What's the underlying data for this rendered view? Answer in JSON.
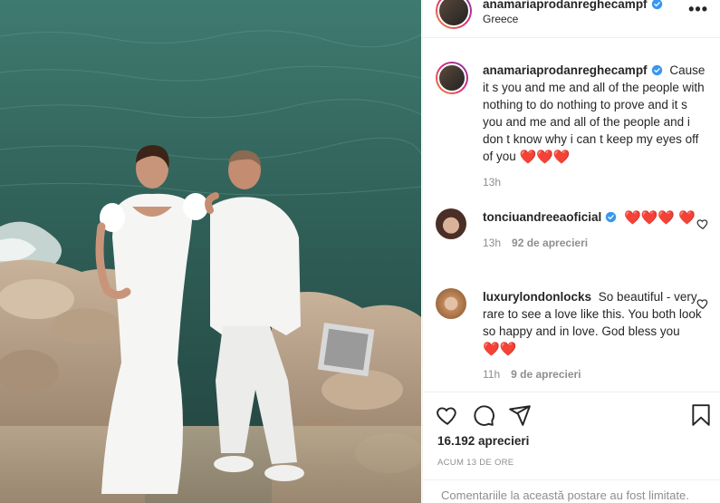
{
  "post": {
    "author": "anamariaprodanreghecampf",
    "location": "Greece",
    "more_icon": "more-horizontal-icon"
  },
  "caption": {
    "username": "anamariaprodanreghecampf",
    "text": "Cause it s you and me and all of the people with nothing to do nothing to prove and it s you and me and all of the people and i don t know why i can t keep my eyes off of you",
    "emoji": "❤️❤️❤️",
    "time": "13h"
  },
  "comments": [
    {
      "username": "tonciuandreeaoficial",
      "text": "❤️❤️❤️ ❤️",
      "time": "13h",
      "likes": "92 de aprecieri"
    },
    {
      "username": "luxurylondonlocks",
      "text": "So beautiful - very rare to see a love like this. You both look so happy and in love. God bless you",
      "emoji": "❤️❤️",
      "time": "11h",
      "likes": "9 de aprecieri"
    }
  ],
  "actions": {
    "like_icon": "heart-icon",
    "comment_icon": "comment-icon",
    "share_icon": "share-icon",
    "save_icon": "bookmark-icon"
  },
  "stats": {
    "likes": "16.192 aprecieri",
    "posted": "ACUM 13 DE ORE"
  },
  "footer": {
    "limited_text": "Comentariile la această postare au fost limitate."
  },
  "colors": {
    "verified": "#3897f0",
    "heart": "#e0245e",
    "muted": "#8e8e8e"
  }
}
